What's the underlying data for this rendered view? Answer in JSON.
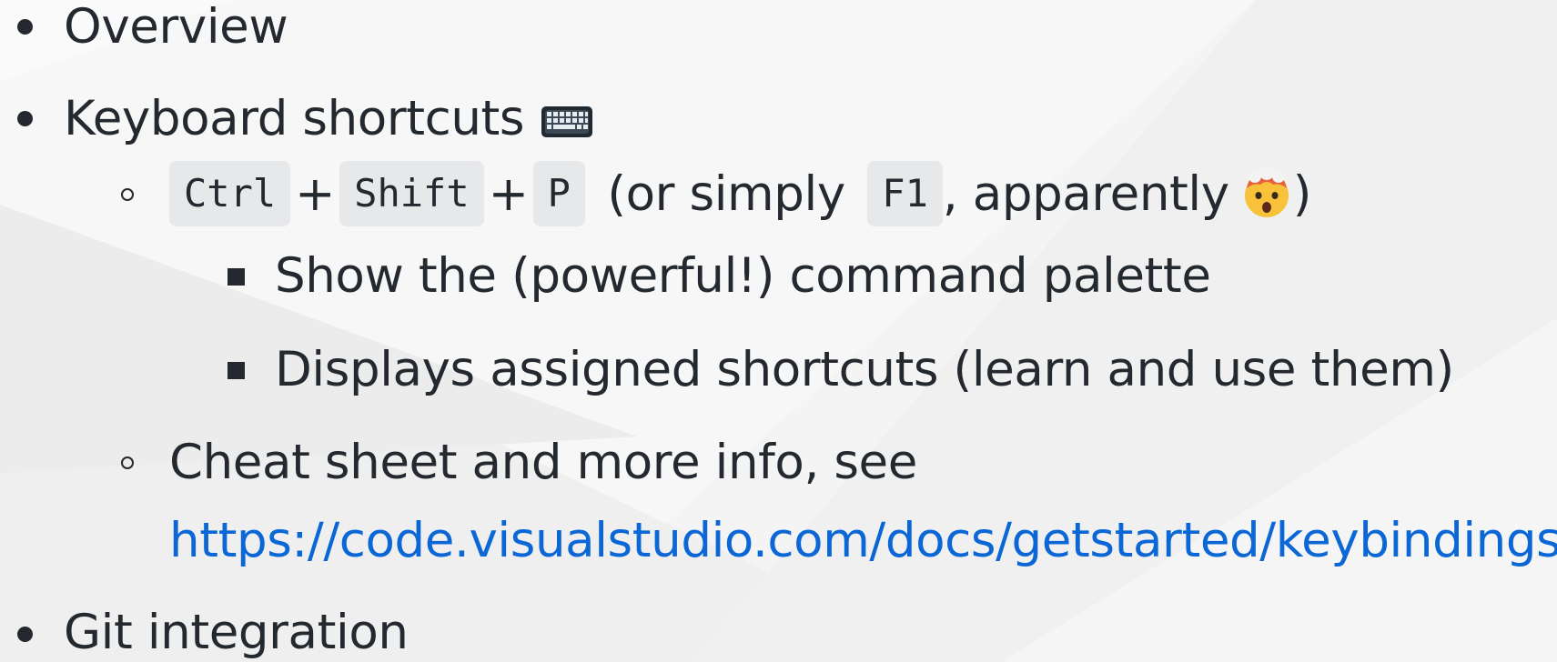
{
  "items": {
    "overview": "Overview",
    "keyboard": "Keyboard shortcuts",
    "keyboard_icon": "keyboard-icon",
    "shortcut": {
      "key1": "Ctrl",
      "plus": "+",
      "key2": "Shift",
      "key3": "P",
      "or_text": "(or simply",
      "key4": "F1",
      "after_text": ", apparently",
      "emoji": "exploding-head-icon",
      "close_paren": ")"
    },
    "sub1": "Show the (powerful!) command palette",
    "sub2": "Displays assigned shortcuts (learn and use them)",
    "cheat": "Cheat sheet and more info, see",
    "link": "https://code.visualstudio.com/docs/getstarted/keybindings",
    "link_after": ".",
    "git": "Git integration"
  },
  "colors": {
    "text": "#24292f",
    "link": "#0b66d6",
    "kbd_bg": "#e7e8ea",
    "background": "#f6f6f6"
  }
}
